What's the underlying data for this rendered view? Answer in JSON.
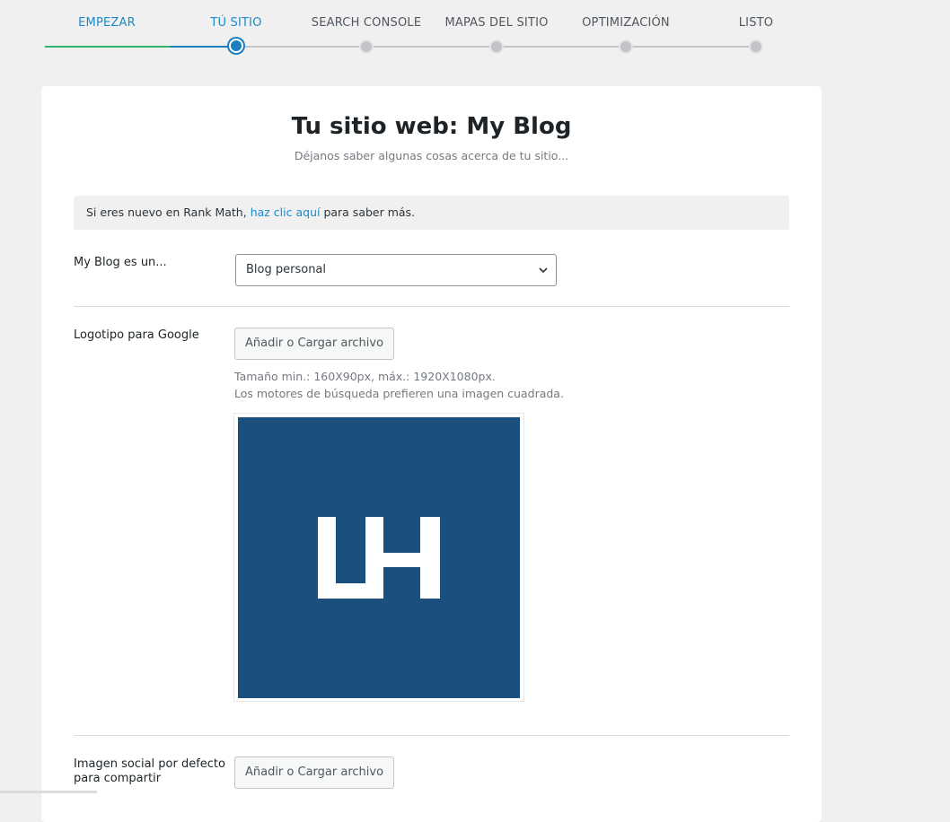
{
  "stepper": {
    "steps": [
      {
        "label": "EMPEZAR",
        "state": "done"
      },
      {
        "label": "TÚ SITIO",
        "state": "current"
      },
      {
        "label": "SEARCH CONSOLE",
        "state": "pending"
      },
      {
        "label": "MAPAS DEL SITIO",
        "state": "pending"
      },
      {
        "label": "OPTIMIZACIÓN",
        "state": "pending"
      },
      {
        "label": "LISTO",
        "state": "pending"
      }
    ]
  },
  "card": {
    "title": "Tu sitio web: My Blog",
    "subtitle": "Déjanos saber algunas cosas acerca de tu sitio...",
    "notice": {
      "prefix": "Si eres nuevo en Rank Math, ",
      "link": "haz clic aquí",
      "suffix": " para saber más."
    },
    "site_type": {
      "label": "My Blog es un...",
      "selected": "Blog personal"
    },
    "logo": {
      "label": "Logotipo para Google",
      "button": "Añadir o Cargar archivo",
      "hint_size": "Tamaño min.: 160X90px, máx.: 1920X1080px.",
      "hint_square": "Los motores de búsqueda prefieren una imagen cuadrada.",
      "image_name": "lh-logo",
      "image_bg": "#1b4f7e"
    },
    "social_image": {
      "label_line1": "Imagen social por defecto",
      "label_line2": "para compartir",
      "button": "Añadir o Cargar archivo"
    }
  },
  "colors": {
    "accent": "#1d8bc9",
    "progress_done": "#2fb26c",
    "progress_current": "#1a7fc1",
    "page_bg": "#f0f0f1"
  }
}
